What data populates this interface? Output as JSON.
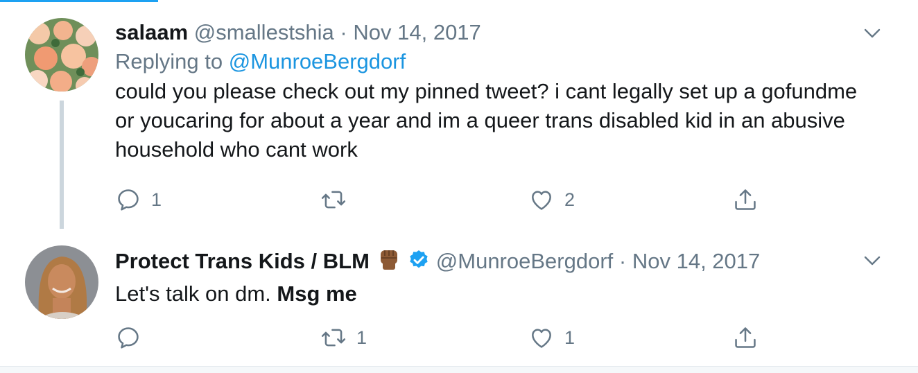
{
  "tweet1": {
    "name": "salaam",
    "handle": "@smallestshia",
    "separator": "·",
    "date": "Nov 14, 2017",
    "replying_prefix": "Replying to",
    "replying_to": "@MunroeBergdorf",
    "text": "could you please check out my pinned tweet? i cant legally set up a gofundme or youcaring for about a year and im a queer trans disabled kid in an abusive household who cant work",
    "reply_count": "1",
    "retweet_count": "",
    "like_count": "2"
  },
  "tweet2": {
    "name": "Protect Trans Kids / BLM",
    "handle": "@MunroeBergdorf",
    "separator": "·",
    "date": "Nov 14, 2017",
    "text_plain": "Let's talk on dm. ",
    "text_bold": "Msg me",
    "reply_count": "",
    "retweet_count": "1",
    "like_count": "1"
  },
  "colors": {
    "accent": "#1da1f2",
    "link": "#1b95e0",
    "muted": "#657786",
    "thread_line": "#ccd6dd"
  },
  "icons": [
    "reply-icon",
    "retweet-icon",
    "like-icon",
    "share-icon",
    "chevron-down-icon",
    "verified-badge-icon",
    "raised-fist-icon"
  ]
}
